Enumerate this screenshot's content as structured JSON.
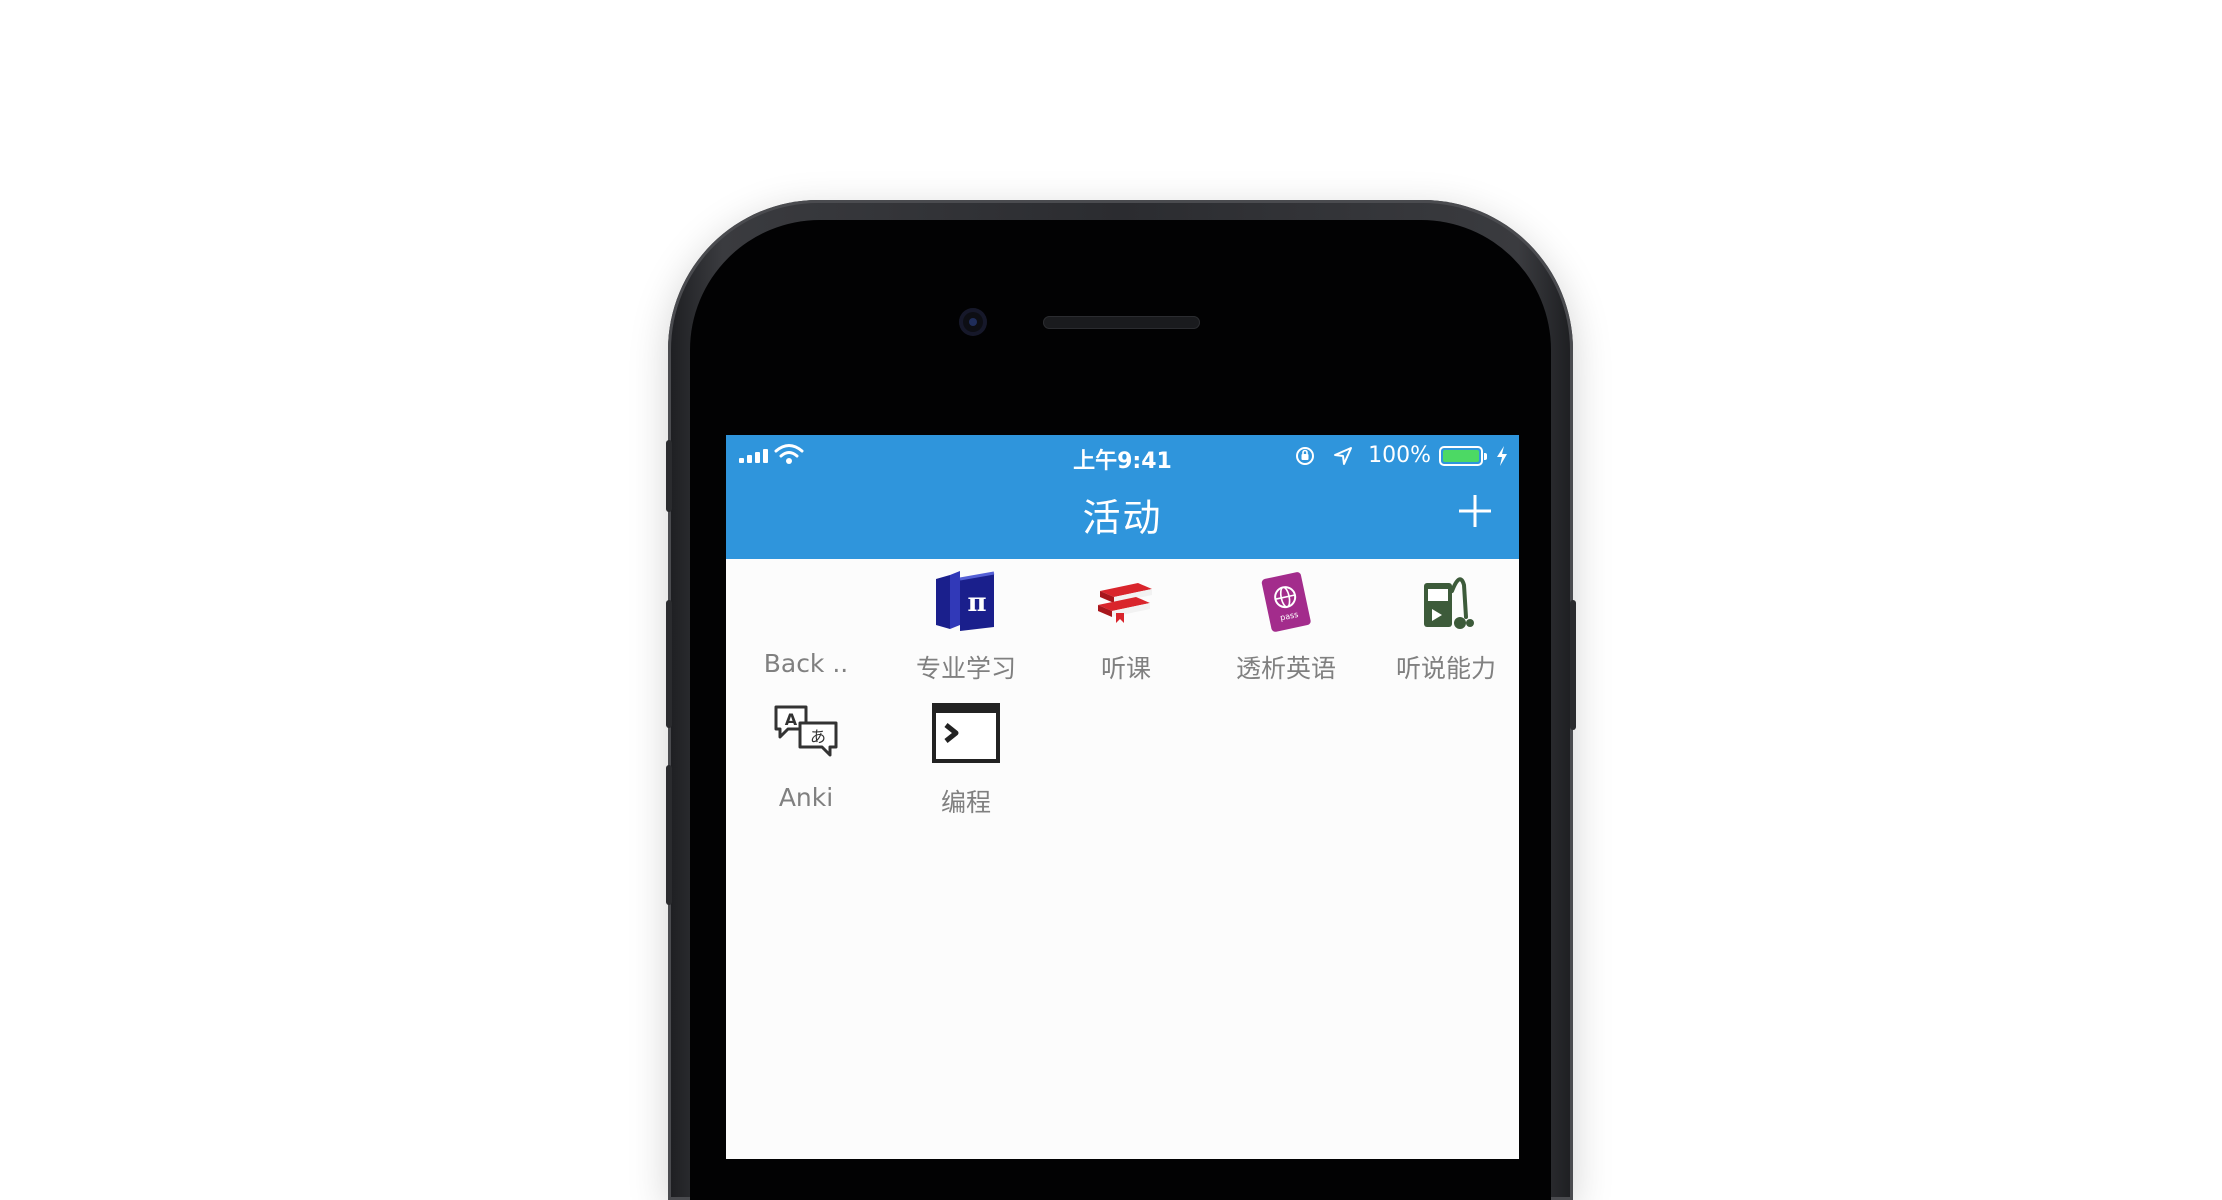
{
  "status_bar": {
    "time": "上午9:41",
    "battery_text": "100%",
    "battery_level": 1.0
  },
  "header": {
    "title": "活动",
    "add_icon": "plus-icon",
    "color": "#2f95dc"
  },
  "activities": [
    {
      "label": "Back ..",
      "icon": "blank-icon"
    },
    {
      "label": "专业学习",
      "icon": "pi-books-icon",
      "color": "#1a1f8c"
    },
    {
      "label": "听课",
      "icon": "red-books-icon",
      "color": "#d9252c"
    },
    {
      "label": "透析英语",
      "icon": "passport-icon",
      "color": "#a32c8c"
    },
    {
      "label": "听说能力",
      "icon": "audio-player-icon",
      "color": "#3d5b3a"
    },
    {
      "label": "Anki",
      "icon": "translate-bubbles-icon",
      "color": "#333333"
    },
    {
      "label": "编程",
      "icon": "terminal-icon",
      "color": "#222222"
    }
  ]
}
